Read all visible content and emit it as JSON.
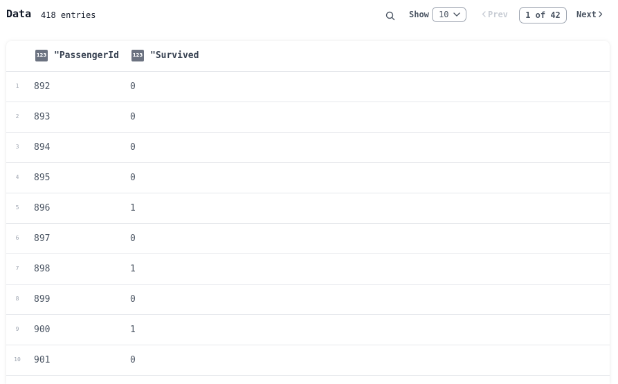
{
  "header": {
    "title": "Data",
    "entries": "418 entries",
    "show_label": "Show",
    "page_size": "10",
    "prev_label": "Prev",
    "page_indicator": "1 of 42",
    "next_label": "Next"
  },
  "table": {
    "columns": [
      {
        "type_icon": "123",
        "label": "\"PassengerId"
      },
      {
        "type_icon": "123",
        "label": "\"Survived"
      }
    ],
    "rows": [
      {
        "n": "1",
        "cells": [
          "892",
          "0"
        ]
      },
      {
        "n": "2",
        "cells": [
          "893",
          "0"
        ]
      },
      {
        "n": "3",
        "cells": [
          "894",
          "0"
        ]
      },
      {
        "n": "4",
        "cells": [
          "895",
          "0"
        ]
      },
      {
        "n": "5",
        "cells": [
          "896",
          "1"
        ]
      },
      {
        "n": "6",
        "cells": [
          "897",
          "0"
        ]
      },
      {
        "n": "7",
        "cells": [
          "898",
          "1"
        ]
      },
      {
        "n": "8",
        "cells": [
          "899",
          "0"
        ]
      },
      {
        "n": "9",
        "cells": [
          "900",
          "1"
        ]
      },
      {
        "n": "10",
        "cells": [
          "901",
          "0"
        ]
      }
    ]
  }
}
